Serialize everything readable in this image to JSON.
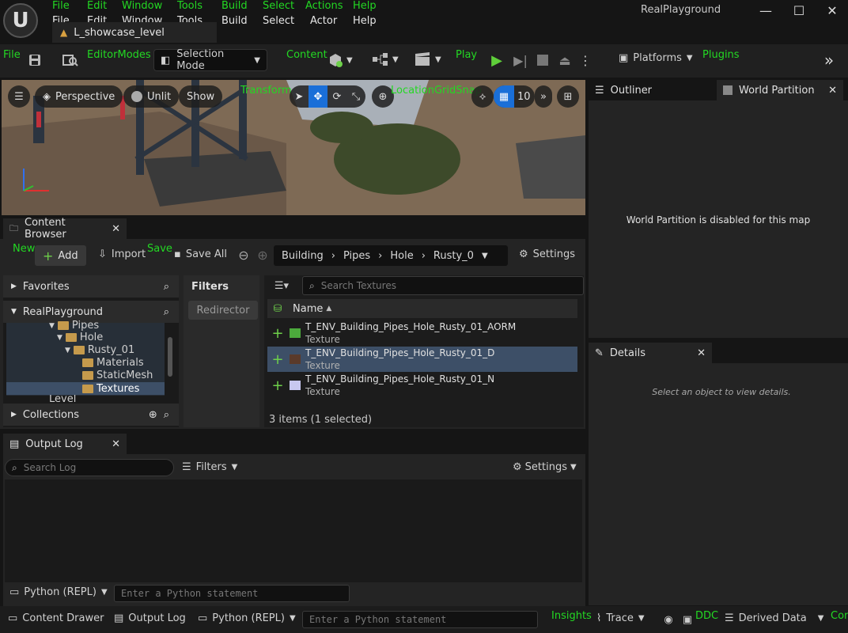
{
  "overlay_labels": {
    "menu_file": "File",
    "menu_edit": "Edit",
    "menu_window": "Window",
    "menu_tools": "Tools",
    "menu_build": "Build",
    "menu_select": "Select",
    "menu_actions": "Actions",
    "menu_help": "Help",
    "toolbar_file": "File",
    "editor_modes": "EditorModes",
    "content": "Content",
    "play": "Play",
    "plugins": "Plugins",
    "transform": "Transform",
    "location_grid_snap": "LocationGridSnap",
    "new": "New",
    "save": "Save",
    "insights": "Insights",
    "ddc": "DDC",
    "con": "Con"
  },
  "menubar": [
    "File",
    "Edit",
    "Window",
    "Tools",
    "Build",
    "Select",
    "Actor",
    "Help"
  ],
  "level_tab": "L_showcase_level",
  "project_name": "RealPlayground",
  "toolbar": {
    "selection_mode": "Selection Mode",
    "platforms": "Platforms"
  },
  "viewport": {
    "perspective": "Perspective",
    "unlit": "Unlit",
    "show": "Show",
    "grid_size": "10"
  },
  "content_browser": {
    "tab_title": "Content Browser",
    "add": "Add",
    "import": "Import",
    "save_all": "Save All",
    "breadcrumb": [
      "Building",
      "Pipes",
      "Hole",
      "Rusty_0"
    ],
    "settings": "Settings",
    "favorites": "Favorites",
    "project_root": "RealPlayground",
    "tree": [
      {
        "label": "Pipes",
        "level": 0
      },
      {
        "label": "Hole",
        "level": 1
      },
      {
        "label": "Rusty_01",
        "level": 2
      },
      {
        "label": "Materials",
        "level": 3
      },
      {
        "label": "StaticMesh",
        "level": 3
      },
      {
        "label": "Textures",
        "level": 3
      },
      {
        "label": "Level",
        "level": 0
      }
    ],
    "collections": "Collections",
    "filters_title": "Filters",
    "filter_chip": "Redirector",
    "search_placeholder": "Search Textures",
    "column_name": "Name",
    "assets": [
      {
        "name": "T_ENV_Building_Pipes_Hole_Rusty_01_AORM",
        "type": "Texture",
        "thumb_color": "#4caa3c"
      },
      {
        "name": "T_ENV_Building_Pipes_Hole_Rusty_01_D",
        "type": "Texture",
        "thumb_color": "#5a3a2a"
      },
      {
        "name": "T_ENV_Building_Pipes_Hole_Rusty_01_N",
        "type": "Texture",
        "thumb_color": "#c8c8f0"
      }
    ],
    "item_count": "3 items (1 selected)"
  },
  "output_log": {
    "tab_title": "Output Log",
    "search_placeholder": "Search Log",
    "filters": "Filters",
    "settings": "Settings",
    "python_mode": "Python (REPL)",
    "python_placeholder": "Enter a Python statement"
  },
  "outliner": {
    "tab_outliner": "Outliner",
    "tab_world_partition": "World Partition",
    "message": "World Partition is disabled for this map"
  },
  "details": {
    "tab_title": "Details",
    "message": "Select an object to view details."
  },
  "statusbar": {
    "content_drawer": "Content Drawer",
    "output_log": "Output Log",
    "python_mode": "Python (REPL)",
    "python_placeholder": "Enter a Python statement",
    "trace": "Trace",
    "derived_data": "Derived Data"
  }
}
